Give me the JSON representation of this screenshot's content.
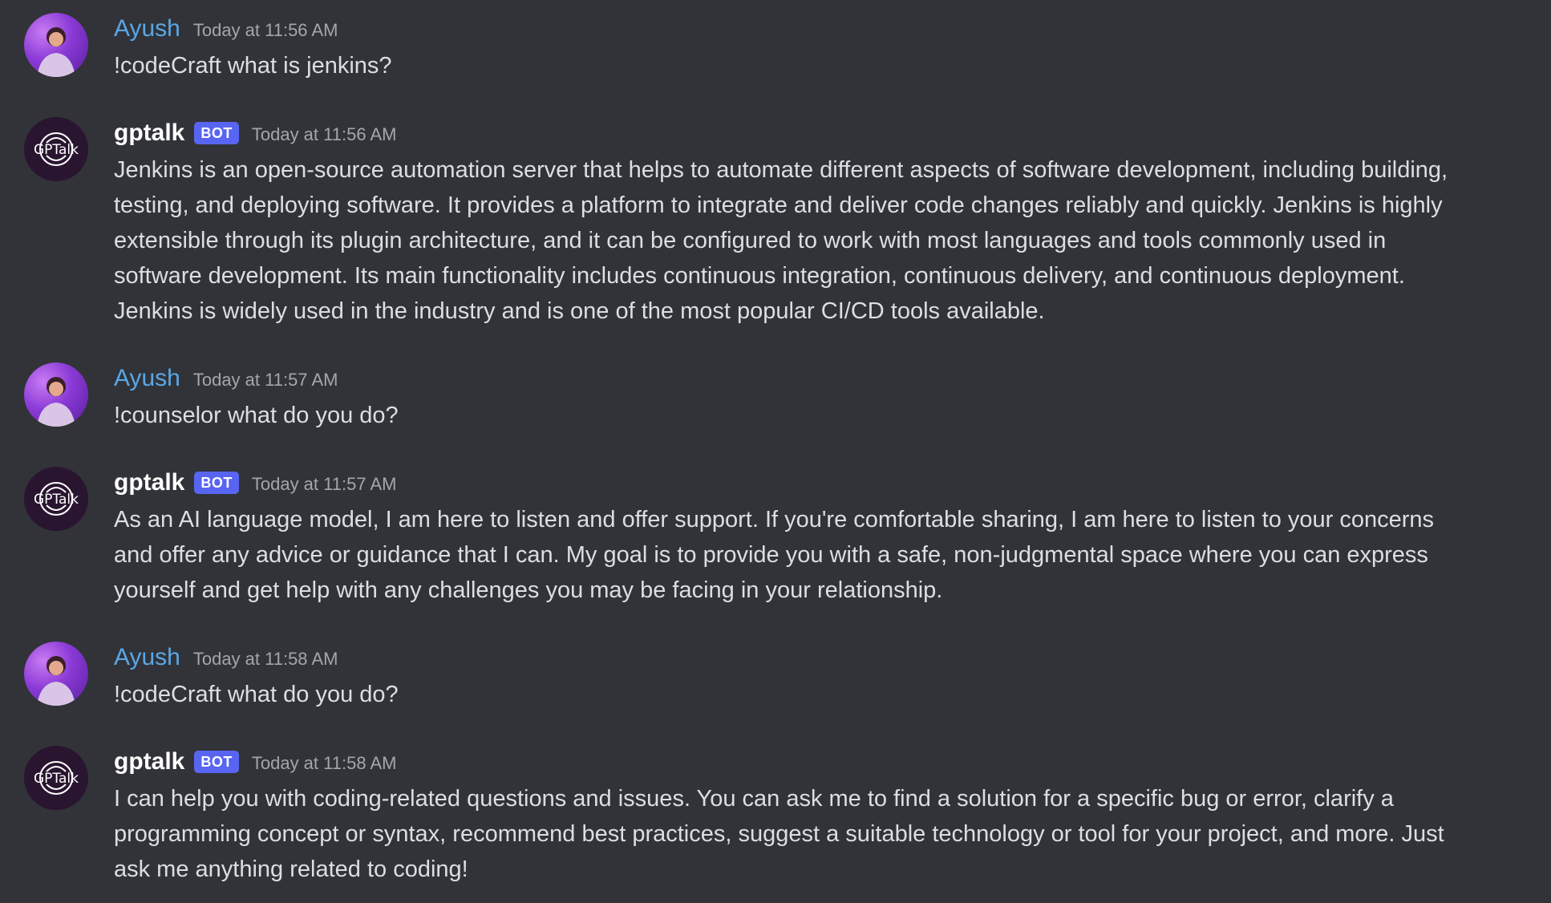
{
  "messages": [
    {
      "author": "Ayush",
      "is_bot": false,
      "timestamp": "Today at 11:56 AM",
      "text": "!codeCraft what is jenkins?"
    },
    {
      "author": "gptalk",
      "is_bot": true,
      "bot_tag": "BOT",
      "timestamp": "Today at 11:56 AM",
      "text": "Jenkins is an open-source automation server that helps to automate different aspects of software development, including building, testing, and deploying software. It provides a platform to integrate and deliver code changes reliably and quickly. Jenkins is highly extensible through its plugin architecture, and it can be configured to work with most languages and tools commonly used in software development. Its main functionality includes continuous integration, continuous delivery, and continuous deployment. Jenkins is widely used in the industry and is one of the most popular CI/CD tools available."
    },
    {
      "author": "Ayush",
      "is_bot": false,
      "timestamp": "Today at 11:57 AM",
      "text": "!counselor what do you do?"
    },
    {
      "author": "gptalk",
      "is_bot": true,
      "bot_tag": "BOT",
      "timestamp": "Today at 11:57 AM",
      "text": "As an AI language model, I am here to listen and offer support. If you're comfortable sharing, I am here to listen to your concerns and offer any advice or guidance that I can. My goal is to provide you with a safe, non-judgmental space where you can express yourself and get help with any challenges you may be facing in your relationship."
    },
    {
      "author": "Ayush",
      "is_bot": false,
      "timestamp": "Today at 11:58 AM",
      "text": "!codeCraft what do you do?"
    },
    {
      "author": "gptalk",
      "is_bot": true,
      "bot_tag": "BOT",
      "timestamp": "Today at 11:58 AM",
      "text": "I can help you with coding-related questions and issues. You can ask me to find a solution for a specific bug or error, clarify a programming concept or syntax, recommend best practices, suggest a suitable technology or tool for your project, and more. Just ask me anything related to coding!"
    }
  ],
  "avatars": {
    "user_icon": "user-avatar",
    "bot_icon": "gptalk-logo",
    "bot_logo_text": "GPTalk"
  },
  "colors": {
    "background": "#313338",
    "user_name": "#5aa7e6",
    "bot_tag": "#5865f2",
    "timestamp": "#a3a6ad",
    "message_text": "#dcdee1"
  }
}
